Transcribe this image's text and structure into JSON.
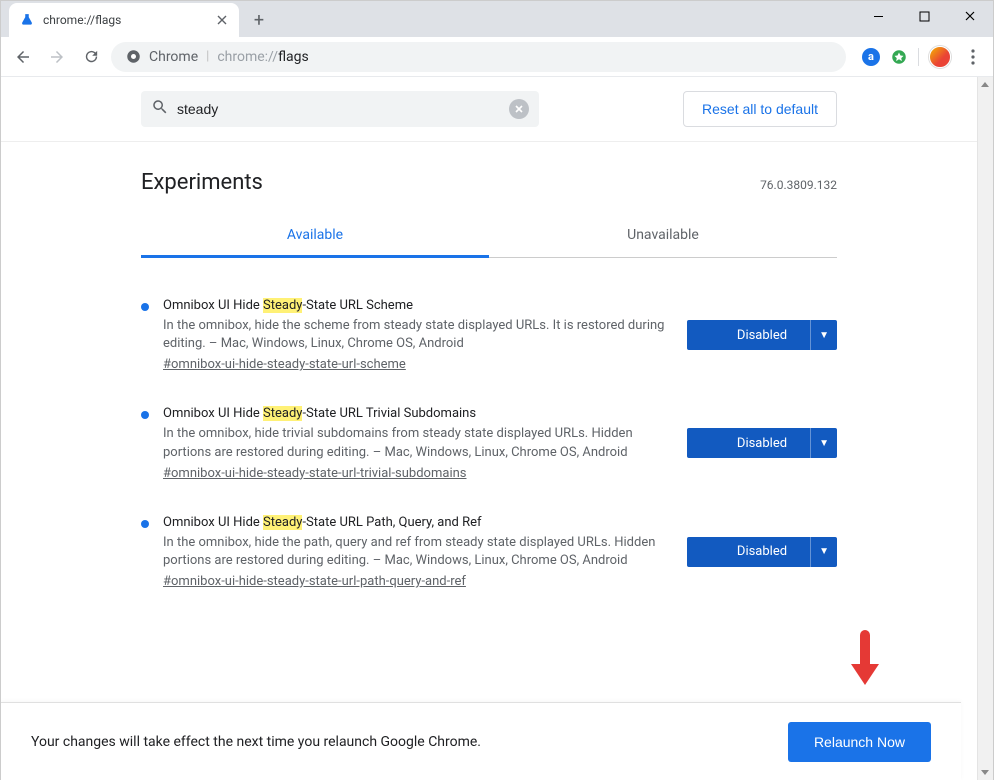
{
  "tab": {
    "title": "chrome://flags"
  },
  "omnibox": {
    "chip": "Chrome",
    "prefix": "chrome://",
    "path": "flags"
  },
  "search": {
    "value": "steady",
    "placeholder": "Search flags"
  },
  "reset_label": "Reset all to default",
  "heading": "Experiments",
  "version": "76.0.3809.132",
  "tabs": {
    "available": "Available",
    "unavailable": "Unavailable"
  },
  "experiments": [
    {
      "title_pre": "Omnibox UI Hide ",
      "title_hl": "Steady",
      "title_post": "-State URL Scheme",
      "desc": "In the omnibox, hide the scheme from steady state displayed URLs. It is restored during editing. – Mac, Windows, Linux, Chrome OS, Android",
      "anchor": "#omnibox-ui-hide-steady-state-url-scheme",
      "state": "Disabled"
    },
    {
      "title_pre": "Omnibox UI Hide ",
      "title_hl": "Steady",
      "title_post": "-State URL Trivial Subdomains",
      "desc": "In the omnibox, hide trivial subdomains from steady state displayed URLs. Hidden portions are restored during editing. – Mac, Windows, Linux, Chrome OS, Android",
      "anchor": "#omnibox-ui-hide-steady-state-url-trivial-subdomains",
      "state": "Disabled"
    },
    {
      "title_pre": "Omnibox UI Hide ",
      "title_hl": "Steady",
      "title_post": "-State URL Path, Query, and Ref",
      "desc": "In the omnibox, hide the path, query and ref from steady state displayed URLs. Hidden portions are restored during editing. – Mac, Windows, Linux, Chrome OS, Android",
      "anchor": "#omnibox-ui-hide-steady-state-url-path-query-and-ref",
      "state": "Disabled"
    }
  ],
  "relaunch": {
    "msg": "Your changes will take effect the next time you relaunch Google Chrome.",
    "btn": "Relaunch Now"
  }
}
